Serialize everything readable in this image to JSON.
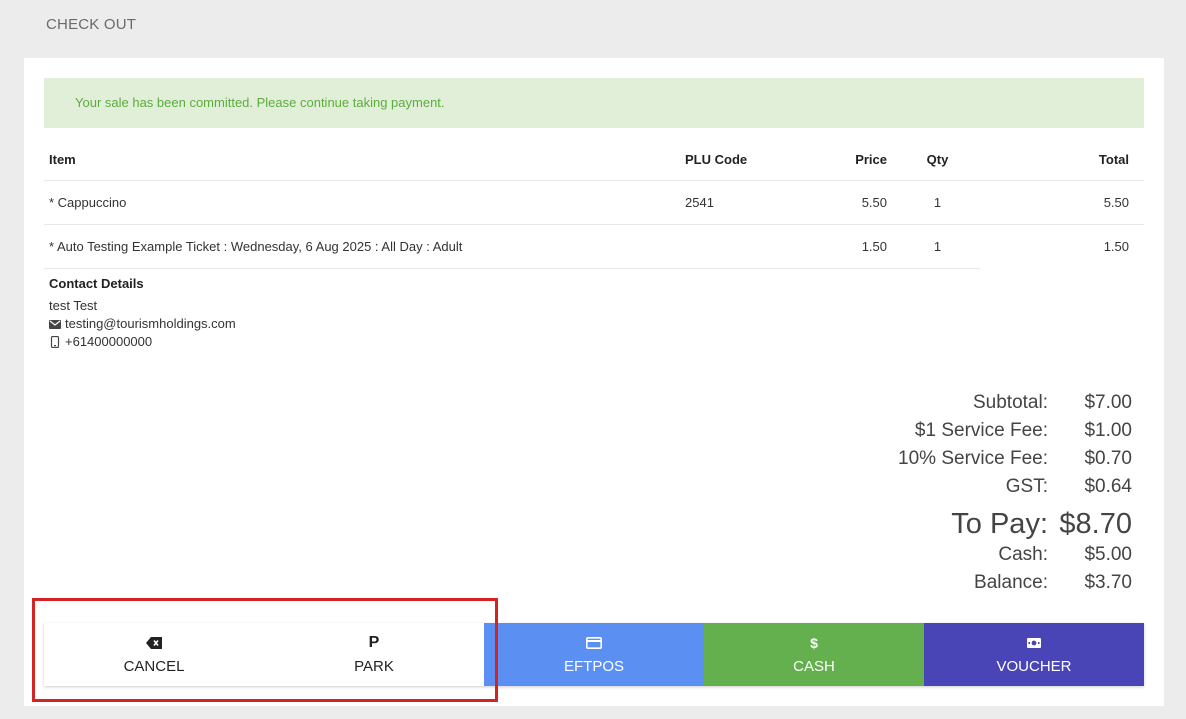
{
  "header": {
    "title": "CHECK OUT"
  },
  "alert": {
    "message": "Your sale has been committed. Please continue taking payment."
  },
  "table": {
    "columns": {
      "item": "Item",
      "plu": "PLU Code",
      "price": "Price",
      "qty": "Qty",
      "total": "Total"
    },
    "rows": [
      {
        "item": "* Cappuccino",
        "plu": "2541",
        "price": "5.50",
        "qty": "1",
        "total": "5.50"
      },
      {
        "item": "* Auto Testing Example Ticket : Wednesday, 6 Aug 2025 : All Day : Adult",
        "plu": "",
        "price": "1.50",
        "qty": "1",
        "total": "1.50"
      }
    ]
  },
  "contact": {
    "title": "Contact Details",
    "name": "test Test",
    "email": "testing@tourismholdings.com",
    "phone": "+61400000000"
  },
  "totals": {
    "subtotal": {
      "label": "Subtotal:",
      "value": "$7.00"
    },
    "fee1": {
      "label": "$1 Service Fee:",
      "value": "$1.00"
    },
    "fee10": {
      "label": "10% Service Fee:",
      "value": "$0.70"
    },
    "gst": {
      "label": "GST:",
      "value": "$0.64"
    },
    "to_pay": {
      "label": "To Pay:",
      "value": "$8.70"
    },
    "cash": {
      "label": "Cash:",
      "value": "$5.00"
    },
    "balance": {
      "label": "Balance:",
      "value": "$3.70"
    }
  },
  "actions": {
    "cancel": {
      "label": "CANCEL",
      "icon": "backspace-icon"
    },
    "park": {
      "label": "PARK",
      "icon": "parking-icon",
      "glyph": "P"
    },
    "eftpos": {
      "label": "EFTPOS",
      "icon": "credit-card-icon"
    },
    "cash": {
      "label": "CASH",
      "icon": "dollar-icon",
      "glyph": "$"
    },
    "voucher": {
      "label": "VOUCHER",
      "icon": "banknote-icon"
    }
  },
  "colors": {
    "alert_bg": "#e1efd8",
    "alert_text": "#5cad3e",
    "eftpos": "#5b8ff2",
    "cash": "#64b04e",
    "voucher": "#4a45b6",
    "highlight": "#d32424"
  }
}
